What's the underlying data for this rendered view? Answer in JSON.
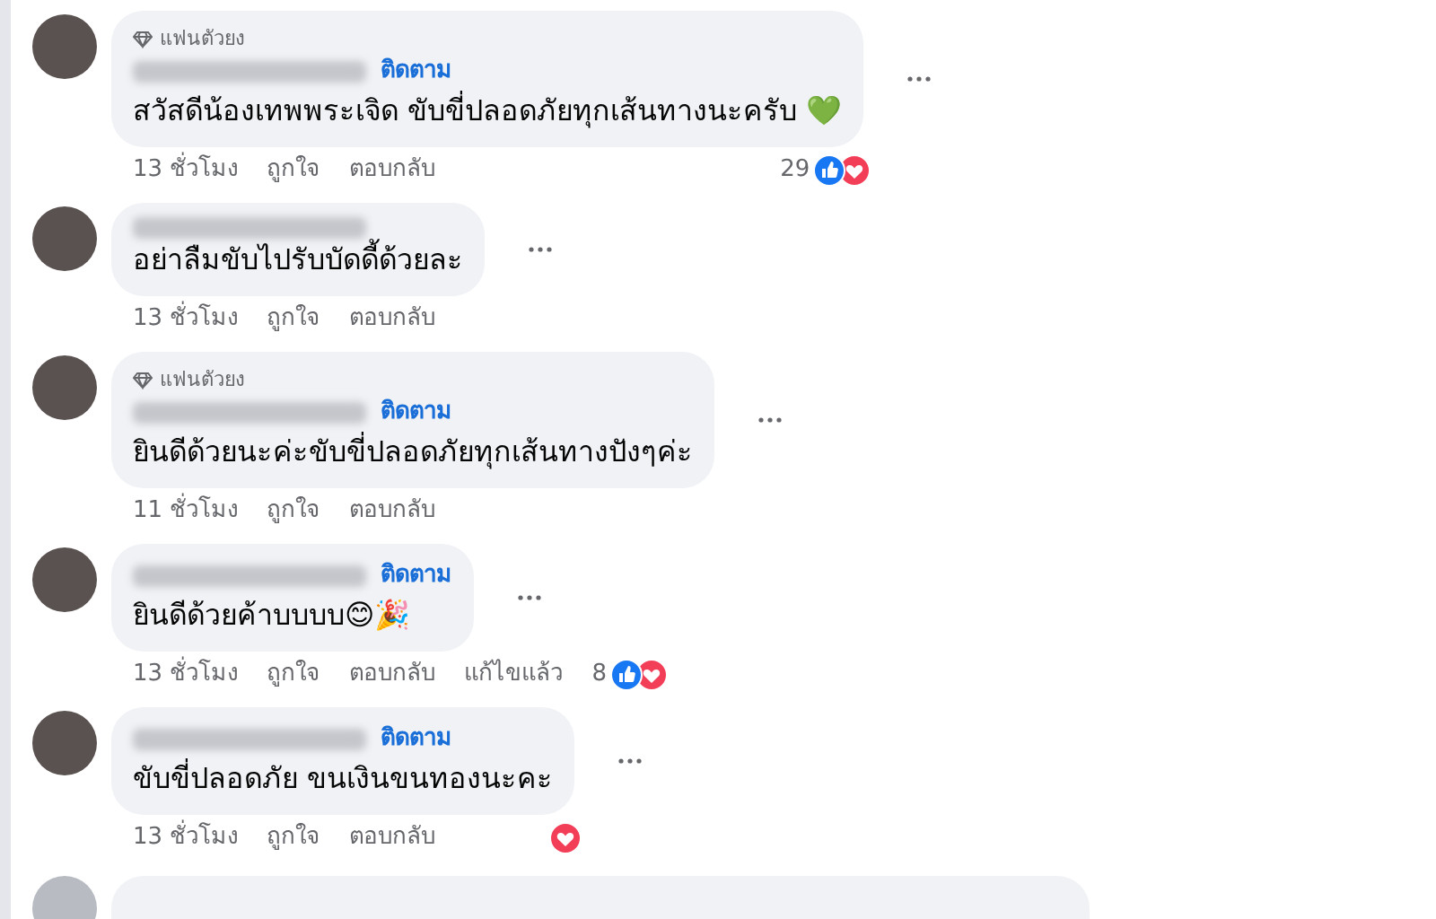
{
  "comments": [
    {
      "badge": "แฟนตัวยง",
      "follow": "ติดตาม",
      "text": "สวัสดีน้องเทพพระเจิด ขับขี่ปลอดภัยทุกเส้นทางนะครับ 💚",
      "time": "13 ชั่วโมง",
      "like": "ถูกใจ",
      "reply": "ตอบกลับ",
      "reactions": {
        "count": "29",
        "like": true,
        "love": true
      }
    },
    {
      "text": "อย่าลืมขับไปรับบัดดี้ด้วยละ",
      "time": "13 ชั่วโมง",
      "like": "ถูกใจ",
      "reply": "ตอบกลับ"
    },
    {
      "badge": "แฟนตัวยง",
      "follow": "ติดตาม",
      "text": "ยินดีด้วยนะค่ะขับขี่ปลอดภัยทุกเส้นทางปังๆค่ะ",
      "time": "11 ชั่วโมง",
      "like": "ถูกใจ",
      "reply": "ตอบกลับ"
    },
    {
      "follow": "ติดตาม",
      "text": "ยินดีด้วยค้าบบบบ😊🎉",
      "time": "13 ชั่วโมง",
      "like": "ถูกใจ",
      "reply": "ตอบกลับ",
      "edited": "แก้ไขแล้ว",
      "reactions": {
        "count": "8",
        "like": true,
        "love": true
      }
    },
    {
      "follow": "ติดตาม",
      "text": "ขับขี่ปลอดภัย ขนเงินขนทองนะคะ",
      "time": "13 ชั่วโมง",
      "like": "ถูกใจ",
      "reply": "ตอบกลับ",
      "reactions": {
        "love": true
      }
    }
  ]
}
